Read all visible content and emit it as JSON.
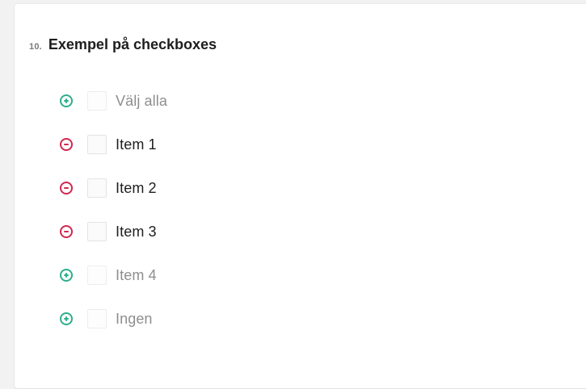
{
  "question": {
    "number": "10.",
    "title": "Exempel på checkboxes"
  },
  "options": [
    {
      "label": "Välj alla",
      "icon": "plus-circle-icon",
      "state": "inactive",
      "checked": false
    },
    {
      "label": "Item 1",
      "icon": "minus-circle-icon",
      "state": "active",
      "checked": false
    },
    {
      "label": "Item 2",
      "icon": "minus-circle-icon",
      "state": "active",
      "checked": false
    },
    {
      "label": "Item 3",
      "icon": "minus-circle-icon",
      "state": "active",
      "checked": false
    },
    {
      "label": "Item 4",
      "icon": "plus-circle-icon",
      "state": "inactive",
      "checked": false
    },
    {
      "label": "Ingen",
      "icon": "plus-circle-icon",
      "state": "inactive",
      "checked": false
    }
  ],
  "colors": {
    "plus": "#2fae8c",
    "minus": "#d2274f",
    "text_active": "#1e1e1e",
    "text_inactive": "#8e8e8e",
    "card_bg": "#ffffff",
    "page_bg": "#f2f2f2"
  }
}
